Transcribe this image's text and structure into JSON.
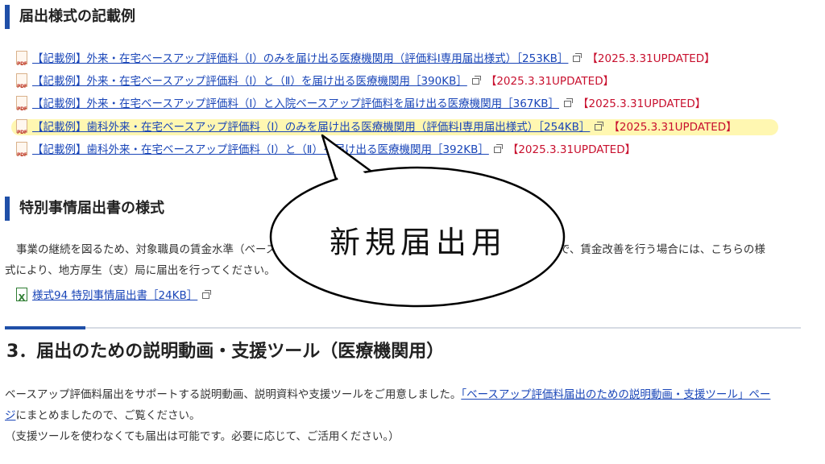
{
  "section1": {
    "title": "届出様式の記載例"
  },
  "docs": [
    {
      "label": "【記載例】外来・在宅ベースアップ評価料（Ⅰ）のみを届け出る医療機関用（評価料Ⅰ専用届出様式）［253KB］",
      "updated": "【2025.3.31UPDATED】"
    },
    {
      "label": "【記載例】外来・在宅ベースアップ評価料（Ⅰ）と（Ⅱ）を届け出る医療機関用［390KB］",
      "updated": "【2025.3.31UPDATED】"
    },
    {
      "label": "【記載例】外来・在宅ベースアップ評価料（Ⅰ）と入院ベースアップ評価料を届け出る医療機関用［367KB］",
      "updated": "【2025.3.31UPDATED】"
    },
    {
      "label": "【記載例】歯科外来・在宅ベースアップ評価料（Ⅰ）のみを届け出る医療機関用（評価料Ⅰ専用届出様式）［254KB］",
      "updated": "【2025.3.31UPDATED】"
    },
    {
      "label": "【記載例】歯科外来・在宅ベースアップ評価料（Ⅰ）と（Ⅱ）を届け出る医療機関用［392KB］",
      "updated": "【2025.3.31UPDATED】"
    }
  ],
  "icons": {
    "pdf": "PDF",
    "xls": "X"
  },
  "section2": {
    "title": "特別事情届出書の様式",
    "para_line1": "事業の継続を図るため、対象職員の賃金水準（ベースアップ等の評価料による賃金改善を除く）を引き下げた上で、賃金改善を行う場合には、こちらの様",
    "para_line2": "式により、地方厚生（支）局に届出を行ってください。",
    "file_label": "様式94 特別事情届出書［24KB］"
  },
  "section3": {
    "title": "3．届出のための説明動画・支援ツール（医療機関用）",
    "para_before_link": "ベースアップ評価料届出をサポートする説明動画、説明資料や支援ツールをご用意しました。",
    "link_text_part1": "「ベースアップ評価料届出のための説明動画・支援ツール」ペー",
    "link_text_part2": "ジ",
    "para_after_link": "にまとめましたので、ご覧ください。",
    "note": "（支援ツールを使わなくても届出は可能です。必要に応じて、ご活用ください。）"
  },
  "callout": {
    "text": "新規届出用"
  },
  "colors": {
    "accent": "#1f4fa8",
    "link": "#1a46b8",
    "updated": "#c8102e",
    "highlight": "#fff6a8"
  }
}
